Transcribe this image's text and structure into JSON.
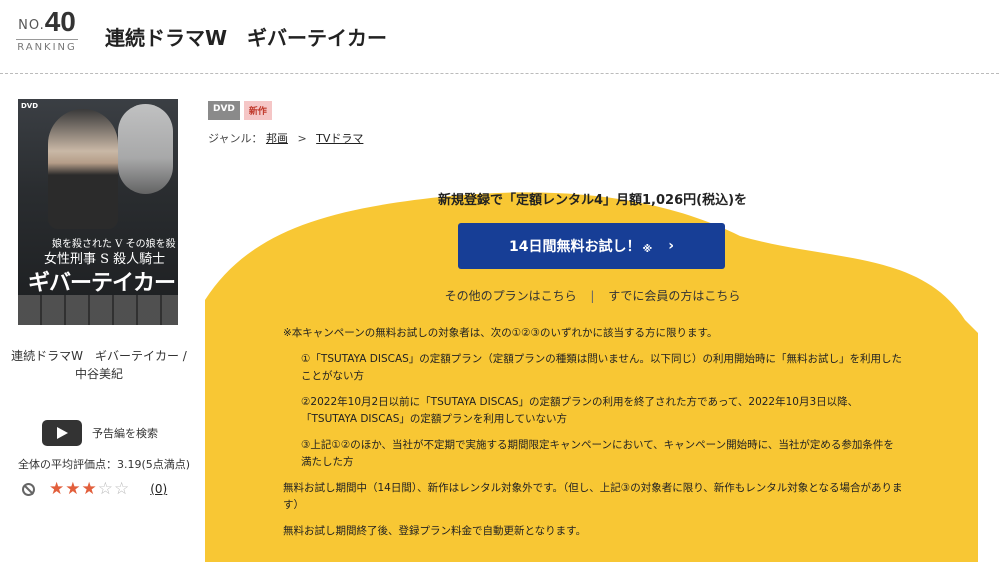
{
  "ranking": {
    "no": "NO.",
    "number": "40",
    "label": "RANKING"
  },
  "title": "連続ドラマW　ギバーテイカー",
  "cover": {
    "dvd": "DVD",
    "sub1": "娘を殺された V その娘を殺した",
    "sub2": "女性刑事 S 殺人騎士",
    "main": "ギバーテイカー"
  },
  "product_name": "連続ドラマW　ギバーテイカー / 中谷美紀",
  "trailer_label": "予告編を検索",
  "rating": {
    "label": "全体の平均評価点：3.19(5点満点)",
    "stars_on": "★★★",
    "stars_off": "☆☆",
    "count": "(0)"
  },
  "badges": {
    "dvd": "DVD",
    "new": "新作"
  },
  "genre": {
    "label": "ジャンル：",
    "crumb1": "邦画",
    "arrow": ">",
    "crumb2": "TVドラマ"
  },
  "promo": {
    "headline": "新規登録で「定額レンタル4」月額1,026円(税込)を",
    "cta": "14日間無料お試し！",
    "cta_note": "※",
    "cta_chevron": "›",
    "link_other": "その他のプランはこちら",
    "link_sep": "|",
    "link_member": "すでに会員の方はこちら",
    "accent": "#f8c734",
    "cta_color": "#173e96"
  },
  "terms": [
    "※本キャンペーンの無料お試しの対象者は、次の①②③のいずれかに該当する方に限ります。",
    "①「TSUTAYA DISCAS」の定額プラン（定額プランの種類は問いません。以下同じ）の利用開始時に「無料お試し」を利用したことがない方",
    "②2022年10月2日以前に「TSUTAYA DISCAS」の定額プランの利用を終了された方であって、2022年10月3日以降、「TSUTAYA DISCAS」の定額プランを利用していない方",
    "③上記①②のほか、当社が不定期で実施する期間限定キャンペーンにおいて、キャンペーン開始時に、当社が定める参加条件を満たした方",
    "無料お試し期間中（14日間）、新作はレンタル対象外です。（但し、上記③の対象者に限り、新作もレンタル対象となる場合があります）",
    "無料お試し期間終了後、登録プラン料金で自動更新となります。"
  ]
}
